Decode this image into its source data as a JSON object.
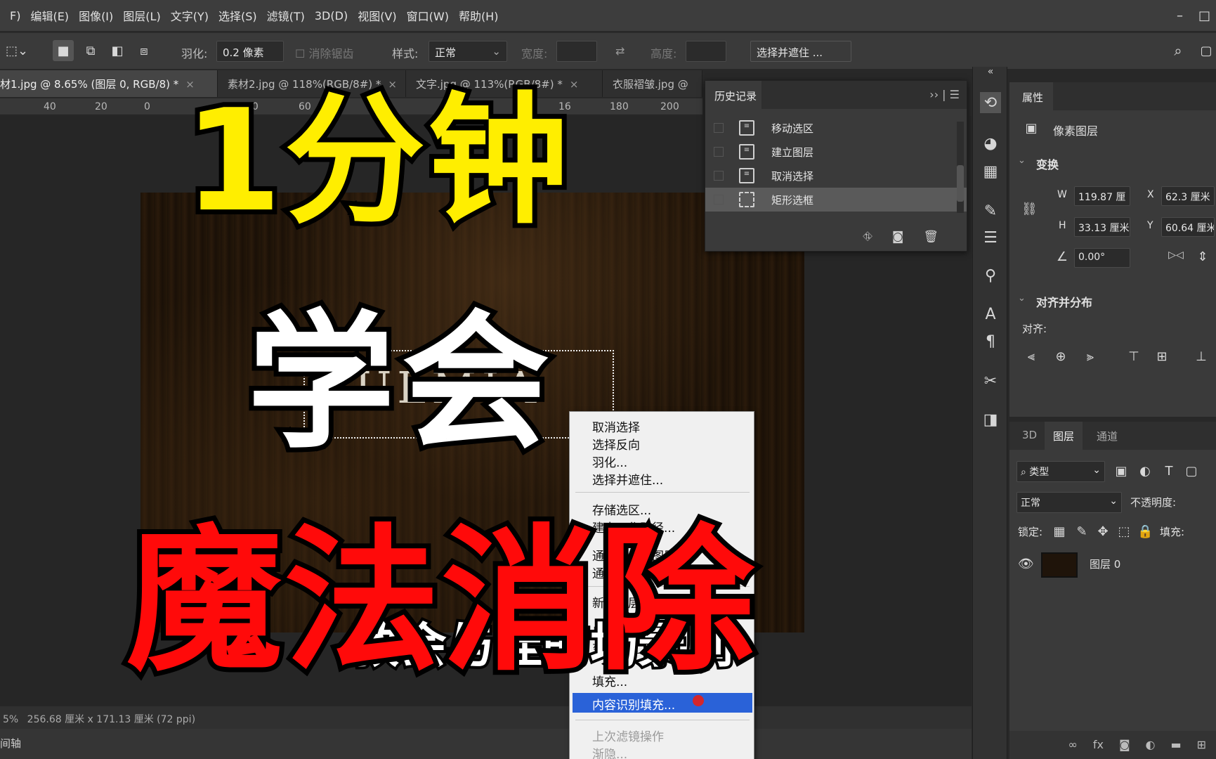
{
  "menu": {
    "items": [
      "F)",
      "编辑(E)",
      "图像(I)",
      "图层(L)",
      "文字(Y)",
      "选择(S)",
      "滤镜(T)",
      "3D(D)",
      "视图(V)",
      "窗口(W)",
      "帮助(H)"
    ],
    "window_controls": [
      "–",
      "□"
    ]
  },
  "options": {
    "feather_label": "羽化:",
    "feather_value": "0.2 像素",
    "antialias_label": "消除锯齿",
    "style_label": "样式:",
    "style_value": "正常",
    "width_label": "宽度:",
    "height_label": "高度:",
    "select_mask_button": "选择并遮住 ..."
  },
  "tabs": [
    {
      "label": "材1.jpg @ 8.65% (图层 0, RGB/8) *",
      "close": "×",
      "active": true
    },
    {
      "label": "素材2.jpg @ 118%(RGB/8#) *",
      "close": "×",
      "active": false
    },
    {
      "label": "文字.jpg @ 113%(RGB/8#) *",
      "close": "×",
      "active": false
    },
    {
      "label": "衣服褶皱.jpg @",
      "close": "",
      "active": false
    }
  ],
  "ruler": {
    "labels": [
      "40",
      "20",
      "0",
      "40",
      "60",
      "120",
      "16",
      "180",
      "200"
    ]
  },
  "canvas": {
    "logo_text": "ULMIA"
  },
  "status": {
    "zoom": "5%",
    "doc_info": "256.68 厘米 x 171.13 厘米 (72 ppi)",
    "bottom_tab": "间轴"
  },
  "history": {
    "title": "历史记录",
    "menu": "›› | ☰",
    "steps": [
      {
        "label": "移动选区",
        "selected": false
      },
      {
        "label": "建立图层",
        "selected": false
      },
      {
        "label": "取消选择",
        "selected": false
      },
      {
        "label": "矩形选框",
        "selected": true
      }
    ]
  },
  "properties": {
    "title": "属性",
    "type": "像素图层",
    "transform_section": "变换",
    "w_label": "W",
    "w_value": "119.87 厘",
    "x_label": "X",
    "x_value": "62.3 厘米",
    "h_label": "H",
    "h_value": "33.13 厘米",
    "y_label": "Y",
    "y_value": "60.64 厘米",
    "angle_value": "0.00°",
    "align_section": "对齐并分布",
    "align_label": "对齐:"
  },
  "layers": {
    "tabs": [
      "3D",
      "图层",
      "通道"
    ],
    "filter_value": "类型",
    "blend_mode": "正常",
    "opacity_label": "不透明度:",
    "lock_label": "锁定:",
    "fill_label": "填充:",
    "layer_name": "图层 0"
  },
  "context_menu": {
    "group1": [
      "取消选择",
      "选择反向",
      "羽化...",
      "选择并遮住..."
    ],
    "group2": [
      "存储选区...",
      "建立工作路径...",
      "通过拷贝的图层",
      "通过剪切的图层"
    ],
    "group3": [
      "新建图层...",
      "自由变换",
      "变换选区",
      "填充..."
    ],
    "highlighted": "内容识别填充...",
    "group4": [
      "上次滤镜操作",
      "渐隐..."
    ]
  },
  "overlay": {
    "line1": "1分钟",
    "line2": "学会",
    "line3": "魔法消除",
    "subtitle": "教会与佳的场景刷"
  },
  "colors": {
    "title_yellow": "#ffee00",
    "title_white": "#ffffff",
    "title_red": "#ff0a0a",
    "menu_highlight": "#2a62d8"
  }
}
